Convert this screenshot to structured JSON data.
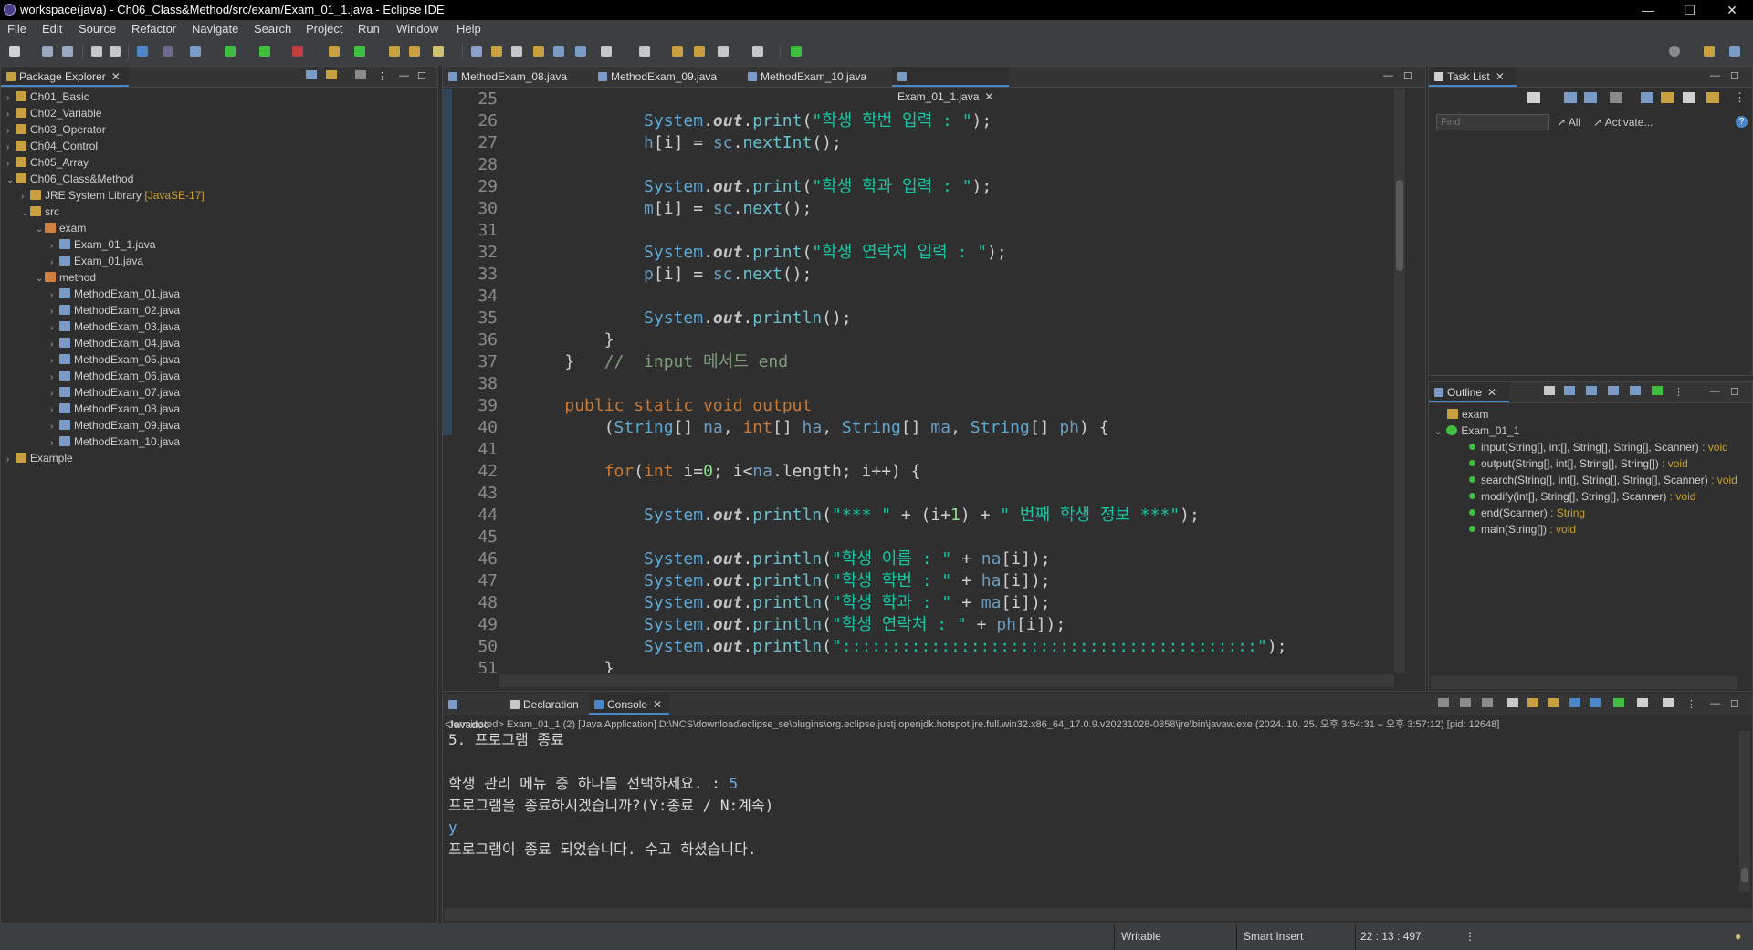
{
  "window": {
    "title": "workspace(java) - Ch06_Class&Method/src/exam/Exam_01_1.java - Eclipse IDE",
    "minimize": "—",
    "restore": "❐",
    "close": "✕"
  },
  "menu": [
    "File",
    "Edit",
    "Source",
    "Refactor",
    "Navigate",
    "Search",
    "Project",
    "Run",
    "Window",
    "Help"
  ],
  "package_explorer": {
    "tab_label": "Package Explorer",
    "items": [
      {
        "label": "Ch01_Basic",
        "indent": 0,
        "arrow": "›",
        "icon": "project"
      },
      {
        "label": "Ch02_Variable",
        "indent": 0,
        "arrow": "›",
        "icon": "project"
      },
      {
        "label": "Ch03_Operator",
        "indent": 0,
        "arrow": "›",
        "icon": "project"
      },
      {
        "label": "Ch04_Control",
        "indent": 0,
        "arrow": "›",
        "icon": "project"
      },
      {
        "label": "Ch05_Array",
        "indent": 0,
        "arrow": "›",
        "icon": "project"
      },
      {
        "label": "Ch06_Class&Method",
        "indent": 0,
        "arrow": "⌄",
        "icon": "project"
      },
      {
        "label": "JRE System Library",
        "suffix": "[JavaSE-17]",
        "indent": 1,
        "arrow": "›",
        "icon": "library"
      },
      {
        "label": "src",
        "indent": 1,
        "arrow": "⌄",
        "icon": "folder"
      },
      {
        "label": "exam",
        "indent": 2,
        "arrow": "⌄",
        "icon": "package"
      },
      {
        "label": "Exam_01_1.java",
        "indent": 3,
        "arrow": "›",
        "icon": "file"
      },
      {
        "label": "Exam_01.java",
        "indent": 3,
        "arrow": "›",
        "icon": "file"
      },
      {
        "label": "method",
        "indent": 2,
        "arrow": "⌄",
        "icon": "package"
      },
      {
        "label": "MethodExam_01.java",
        "indent": 3,
        "arrow": "›",
        "icon": "file"
      },
      {
        "label": "MethodExam_02.java",
        "indent": 3,
        "arrow": "›",
        "icon": "file"
      },
      {
        "label": "MethodExam_03.java",
        "indent": 3,
        "arrow": "›",
        "icon": "file"
      },
      {
        "label": "MethodExam_04.java",
        "indent": 3,
        "arrow": "›",
        "icon": "file"
      },
      {
        "label": "MethodExam_05.java",
        "indent": 3,
        "arrow": "›",
        "icon": "file"
      },
      {
        "label": "MethodExam_06.java",
        "indent": 3,
        "arrow": "›",
        "icon": "file"
      },
      {
        "label": "MethodExam_07.java",
        "indent": 3,
        "arrow": "›",
        "icon": "file"
      },
      {
        "label": "MethodExam_08.java",
        "indent": 3,
        "arrow": "›",
        "icon": "file"
      },
      {
        "label": "MethodExam_09.java",
        "indent": 3,
        "arrow": "›",
        "icon": "file"
      },
      {
        "label": "MethodExam_10.java",
        "indent": 3,
        "arrow": "›",
        "icon": "file"
      },
      {
        "label": "Example",
        "indent": 0,
        "arrow": "›",
        "icon": "project"
      }
    ]
  },
  "editor": {
    "tabs": [
      {
        "label": "MethodExam_08.java",
        "active": false
      },
      {
        "label": "MethodExam_09.java",
        "active": false
      },
      {
        "label": "MethodExam_10.java",
        "active": false
      },
      {
        "label": "Exam_01_1.java",
        "active": true
      }
    ],
    "lines": [
      {
        "n": "25",
        "tokens": []
      },
      {
        "n": "26",
        "tokens": [
          [
            "            ",
            "pu"
          ],
          [
            "System",
            "ty"
          ],
          [
            ".",
            "pu"
          ],
          [
            "out",
            "st"
          ],
          [
            ".",
            "pu"
          ],
          [
            "print",
            "mth"
          ],
          [
            "(",
            "pu"
          ],
          [
            "\"학생 학번 입력 : \"",
            "str"
          ],
          [
            ");",
            "pu"
          ]
        ]
      },
      {
        "n": "27",
        "tokens": [
          [
            "            ",
            "pu"
          ],
          [
            "h",
            "fld"
          ],
          [
            "[i] = ",
            "pu"
          ],
          [
            "sc",
            "fld"
          ],
          [
            ".",
            "pu"
          ],
          [
            "nextInt",
            "mth"
          ],
          [
            "();",
            "pu"
          ]
        ]
      },
      {
        "n": "28",
        "tokens": []
      },
      {
        "n": "29",
        "tokens": [
          [
            "            ",
            "pu"
          ],
          [
            "System",
            "ty"
          ],
          [
            ".",
            "pu"
          ],
          [
            "out",
            "st"
          ],
          [
            ".",
            "pu"
          ],
          [
            "print",
            "mth"
          ],
          [
            "(",
            "pu"
          ],
          [
            "\"학생 학과 입력 : \"",
            "str"
          ],
          [
            ");",
            "pu"
          ]
        ]
      },
      {
        "n": "30",
        "tokens": [
          [
            "            ",
            "pu"
          ],
          [
            "m",
            "fld"
          ],
          [
            "[i] = ",
            "pu"
          ],
          [
            "sc",
            "fld"
          ],
          [
            ".",
            "pu"
          ],
          [
            "next",
            "mth"
          ],
          [
            "();",
            "pu"
          ]
        ]
      },
      {
        "n": "31",
        "tokens": []
      },
      {
        "n": "32",
        "tokens": [
          [
            "            ",
            "pu"
          ],
          [
            "System",
            "ty"
          ],
          [
            ".",
            "pu"
          ],
          [
            "out",
            "st"
          ],
          [
            ".",
            "pu"
          ],
          [
            "print",
            "mth"
          ],
          [
            "(",
            "pu"
          ],
          [
            "\"학생 연락처 입력 : \"",
            "str"
          ],
          [
            ");",
            "pu"
          ]
        ]
      },
      {
        "n": "33",
        "tokens": [
          [
            "            ",
            "pu"
          ],
          [
            "p",
            "fld"
          ],
          [
            "[i] = ",
            "pu"
          ],
          [
            "sc",
            "fld"
          ],
          [
            ".",
            "pu"
          ],
          [
            "next",
            "mth"
          ],
          [
            "();",
            "pu"
          ]
        ]
      },
      {
        "n": "34",
        "tokens": []
      },
      {
        "n": "35",
        "tokens": [
          [
            "            ",
            "pu"
          ],
          [
            "System",
            "ty"
          ],
          [
            ".",
            "pu"
          ],
          [
            "out",
            "st"
          ],
          [
            ".",
            "pu"
          ],
          [
            "println",
            "mth"
          ],
          [
            "();",
            "pu"
          ]
        ]
      },
      {
        "n": "36",
        "tokens": [
          [
            "        }",
            "pu"
          ]
        ]
      },
      {
        "n": "37",
        "tokens": [
          [
            "    }   ",
            "pu"
          ],
          [
            "//  input 메서드 end",
            "cm"
          ]
        ]
      },
      {
        "n": "38",
        "tokens": []
      },
      {
        "n": "39",
        "tokens": [
          [
            "    ",
            "pu"
          ],
          [
            "public static void ",
            "kw"
          ],
          [
            "output",
            "kw"
          ]
        ]
      },
      {
        "n": "40",
        "tokens": [
          [
            "        (",
            "pu"
          ],
          [
            "String",
            "ty"
          ],
          [
            "[] ",
            "pu"
          ],
          [
            "na",
            "fld"
          ],
          [
            ", ",
            "pu"
          ],
          [
            "int",
            "kw"
          ],
          [
            "[] ",
            "pu"
          ],
          [
            "ha",
            "fld"
          ],
          [
            ", ",
            "pu"
          ],
          [
            "String",
            "ty"
          ],
          [
            "[] ",
            "pu"
          ],
          [
            "ma",
            "fld"
          ],
          [
            ", ",
            "pu"
          ],
          [
            "String",
            "ty"
          ],
          [
            "[] ",
            "pu"
          ],
          [
            "ph",
            "fld"
          ],
          [
            ") {",
            "pu"
          ]
        ]
      },
      {
        "n": "41",
        "tokens": []
      },
      {
        "n": "42",
        "tokens": [
          [
            "        ",
            "pu"
          ],
          [
            "for",
            "kw"
          ],
          [
            "(",
            "pu"
          ],
          [
            "int",
            "kw"
          ],
          [
            " i=",
            "pu"
          ],
          [
            "0",
            "num"
          ],
          [
            "; i<",
            "pu"
          ],
          [
            "na",
            "fld"
          ],
          [
            ".length; i++) {",
            "pu"
          ]
        ]
      },
      {
        "n": "43",
        "tokens": []
      },
      {
        "n": "44",
        "tokens": [
          [
            "            ",
            "pu"
          ],
          [
            "System",
            "ty"
          ],
          [
            ".",
            "pu"
          ],
          [
            "out",
            "st"
          ],
          [
            ".",
            "pu"
          ],
          [
            "println",
            "mth"
          ],
          [
            "(",
            "pu"
          ],
          [
            "\"*** \"",
            "str"
          ],
          [
            " + (i+",
            "pu"
          ],
          [
            "1",
            "num"
          ],
          [
            ") + ",
            "pu"
          ],
          [
            "\" 번째 학생 정보 ***\"",
            "str"
          ],
          [
            ");",
            "pu"
          ]
        ]
      },
      {
        "n": "45",
        "tokens": []
      },
      {
        "n": "46",
        "tokens": [
          [
            "            ",
            "pu"
          ],
          [
            "System",
            "ty"
          ],
          [
            ".",
            "pu"
          ],
          [
            "out",
            "st"
          ],
          [
            ".",
            "pu"
          ],
          [
            "println",
            "mth"
          ],
          [
            "(",
            "pu"
          ],
          [
            "\"학생 이름 : \"",
            "str"
          ],
          [
            " + ",
            "pu"
          ],
          [
            "na",
            "fld"
          ],
          [
            "[i]);",
            "pu"
          ]
        ]
      },
      {
        "n": "47",
        "tokens": [
          [
            "            ",
            "pu"
          ],
          [
            "System",
            "ty"
          ],
          [
            ".",
            "pu"
          ],
          [
            "out",
            "st"
          ],
          [
            ".",
            "pu"
          ],
          [
            "println",
            "mth"
          ],
          [
            "(",
            "pu"
          ],
          [
            "\"학생 학번 : \"",
            "str"
          ],
          [
            " + ",
            "pu"
          ],
          [
            "ha",
            "fld"
          ],
          [
            "[i]);",
            "pu"
          ]
        ]
      },
      {
        "n": "48",
        "tokens": [
          [
            "            ",
            "pu"
          ],
          [
            "System",
            "ty"
          ],
          [
            ".",
            "pu"
          ],
          [
            "out",
            "st"
          ],
          [
            ".",
            "pu"
          ],
          [
            "println",
            "mth"
          ],
          [
            "(",
            "pu"
          ],
          [
            "\"학생 학과 : \"",
            "str"
          ],
          [
            " + ",
            "pu"
          ],
          [
            "ma",
            "fld"
          ],
          [
            "[i]);",
            "pu"
          ]
        ]
      },
      {
        "n": "49",
        "tokens": [
          [
            "            ",
            "pu"
          ],
          [
            "System",
            "ty"
          ],
          [
            ".",
            "pu"
          ],
          [
            "out",
            "st"
          ],
          [
            ".",
            "pu"
          ],
          [
            "println",
            "mth"
          ],
          [
            "(",
            "pu"
          ],
          [
            "\"학생 연락처 : \"",
            "str"
          ],
          [
            " + ",
            "pu"
          ],
          [
            "ph",
            "fld"
          ],
          [
            "[i]);",
            "pu"
          ]
        ]
      },
      {
        "n": "50",
        "tokens": [
          [
            "            ",
            "pu"
          ],
          [
            "System",
            "ty"
          ],
          [
            ".",
            "pu"
          ],
          [
            "out",
            "st"
          ],
          [
            ".",
            "pu"
          ],
          [
            "println",
            "mth"
          ],
          [
            "(",
            "pu"
          ],
          [
            "\"::::::::::::::::::::::::::::::::::::::::::\"",
            "str"
          ],
          [
            ");",
            "pu"
          ]
        ]
      },
      {
        "n": "51",
        "tokens": [
          [
            "        }",
            "pu"
          ]
        ]
      }
    ]
  },
  "task_list": {
    "tab_label": "Task List",
    "find_placeholder": "Find",
    "all_label": "All",
    "activate_label": "Activate..."
  },
  "outline": {
    "tab_label": "Outline",
    "package": "exam",
    "class": "Exam_01_1",
    "methods": [
      {
        "sig": "input(String[], int[], String[], String[], Scanner)",
        "ret": " : void"
      },
      {
        "sig": "output(String[], int[], String[], String[])",
        "ret": " : void"
      },
      {
        "sig": "search(String[], int[], String[], String[], Scanner)",
        "ret": " : void"
      },
      {
        "sig": "modify(int[], String[], String[], Scanner)",
        "ret": " : void"
      },
      {
        "sig": "end(Scanner)",
        "ret": " : String"
      },
      {
        "sig": "main(String[])",
        "ret": " : void"
      }
    ]
  },
  "bottom_panel": {
    "tabs": [
      {
        "label": "Javadoc",
        "active": false
      },
      {
        "label": "Declaration",
        "active": false
      },
      {
        "label": "Console",
        "active": true
      }
    ],
    "terminated_line": "<terminated> Exam_01_1 (2) [Java Application] D:\\NCS\\download\\eclipse_se\\plugins\\org.eclipse.justj.openjdk.hotspot.jre.full.win32.x86_64_17.0.9.v20231028-0858\\jre\\bin\\javaw.exe  (2024. 10. 25. 오후 3:54:31 – 오후 3:57:12) [pid: 12648]",
    "console_lines": [
      {
        "text": "5. 프로그램 종료",
        "color": "#d8d8d8"
      },
      {
        "text": "",
        "color": "#d8d8d8"
      },
      {
        "text": "학생 관리 메뉴 중 하나를 선택하세요. : ",
        "color": "#d8d8d8",
        "input": "5"
      },
      {
        "text": "프로그램을 종료하시겠습니까?(Y:종료 / N:계속)",
        "color": "#d8d8d8"
      },
      {
        "text": "",
        "color": "#d8d8d8",
        "input": "y"
      },
      {
        "text": "프로그램이 종료 되었습니다. 수고 하셨습니다.",
        "color": "#d8d8d8"
      }
    ],
    "input_color": "#6aaee6"
  },
  "status_bar": {
    "writable": "Writable",
    "insert_mode": "Smart Insert",
    "position": "22 : 13 : 497"
  }
}
